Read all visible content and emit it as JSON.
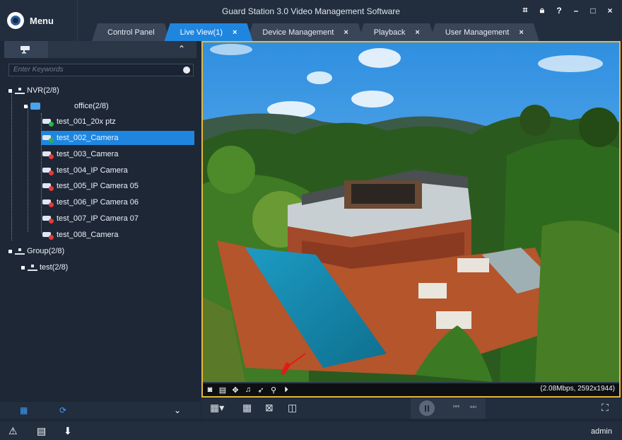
{
  "window": {
    "menu_label": "Menu",
    "title": "Guard Station 3.0 Video Management Software",
    "controls": [
      "pin-icon",
      "lock-icon",
      "help-icon",
      "minimize-icon",
      "maximize-icon",
      "close-icon"
    ]
  },
  "tabs": [
    {
      "label": "Control Panel",
      "closable": false,
      "active": false
    },
    {
      "label": "Live View(1)",
      "closable": true,
      "active": true
    },
    {
      "label": "Device Management",
      "closable": true,
      "active": false
    },
    {
      "label": "Playback",
      "closable": true,
      "active": false
    },
    {
      "label": "User Management",
      "closable": true,
      "active": false
    }
  ],
  "tab_close_glyph": "×",
  "sidebar": {
    "search_placeholder": "Enter Keywords",
    "tree": {
      "nvr": {
        "label": "NVR(2/8)"
      },
      "office": {
        "label": "office(2/8)"
      },
      "cameras": [
        {
          "label": "test_001_20x ptz",
          "status": "online"
        },
        {
          "label": "test_002_Camera",
          "status": "online",
          "selected": true
        },
        {
          "label": "test_003_Camera",
          "status": "offline"
        },
        {
          "label": "test_004_IP Camera",
          "status": "offline"
        },
        {
          "label": "test_005_IP Camera 05",
          "status": "offline"
        },
        {
          "label": "test_006_IP Camera 06",
          "status": "offline"
        },
        {
          "label": "test_007_IP Camera 07",
          "status": "offline"
        },
        {
          "label": "test_008_Camera",
          "status": "offline"
        }
      ],
      "group": {
        "label": "Group(2/8)"
      },
      "group_child": {
        "label": "test(2/8)"
      }
    }
  },
  "video": {
    "stream_info": "(2.08Mbps, 2592x1944)",
    "toolbar_icons": [
      "snapshot-icon",
      "record-icon",
      "ptz-icon",
      "audio-icon",
      "talk-icon",
      "digital-zoom-icon",
      "playback-icon"
    ]
  },
  "status": {
    "user": "admin"
  },
  "colors": {
    "accent": "#1f86e0",
    "selection_border": "#e5b93a",
    "online": "#2bb34a",
    "offline": "#e23b3b"
  }
}
